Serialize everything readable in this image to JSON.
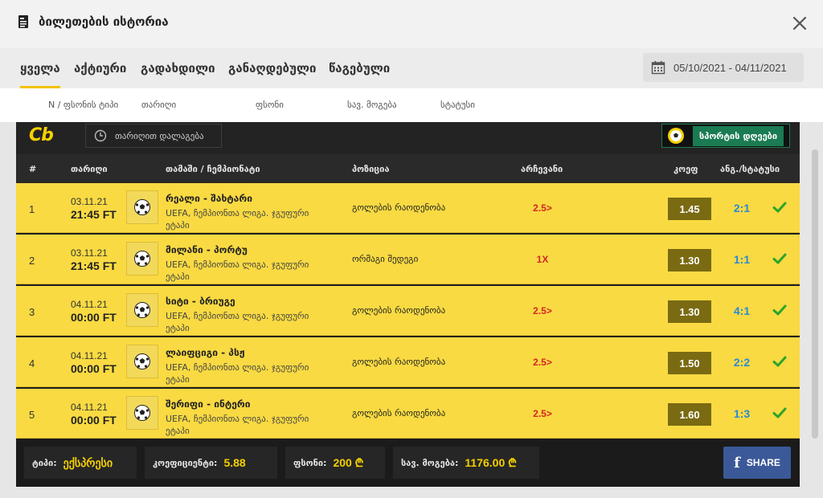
{
  "header": {
    "title": "ბილეთების ისტორია"
  },
  "tabs": [
    {
      "label": "ყველა",
      "active": true
    },
    {
      "label": "აქტიური",
      "active": false
    },
    {
      "label": "გადახდილი",
      "active": false
    },
    {
      "label": "განაღდებული",
      "active": false
    },
    {
      "label": "წაგებული",
      "active": false
    }
  ],
  "date_range": {
    "value": "05/10/2021 - 04/11/2021"
  },
  "columns": {
    "n_type": "N / ფსონის ტიპი",
    "date": "თარიღი",
    "stake": "ფსონი",
    "potential_win": "სავ. მოგება",
    "status": "სტატუსი"
  },
  "ticket": {
    "logo": "Cb",
    "sort_label": "თარიღით დალაგება",
    "sports_button_label": "სპორტის დღეები",
    "table_headers": {
      "num": "#",
      "date": "თარიღი",
      "event": "თამაში / ჩემპიონატი",
      "market": "პოზიცია",
      "outcome": "არჩევანი",
      "odds": "კოეფ",
      "result": "ანგ./სტატუსი"
    },
    "rows": [
      {
        "num": "1",
        "date": "03.11.21",
        "time": "21:45 FT",
        "teams": "რეალი - შახტარი",
        "league": "UEFA, ჩემპიონთა ლიგა. ჯგუფური ეტაპი",
        "market": "გოლების რაოდენობა",
        "outcome": "2.5>",
        "odds": "1.45",
        "score": "2:1"
      },
      {
        "num": "2",
        "date": "03.11.21",
        "time": "21:45 FT",
        "teams": "მილანი - პორტუ",
        "league": "UEFA, ჩემპიონთა ლიგა. ჯგუფური ეტაპი",
        "market": "ორმაგი შედეგი",
        "outcome": "1X",
        "odds": "1.30",
        "score": "1:1"
      },
      {
        "num": "3",
        "date": "04.11.21",
        "time": "00:00 FT",
        "teams": "სიტი - ბრიუგე",
        "league": "UEFA, ჩემპიონთა ლიგა. ჯგუფური ეტაპი",
        "market": "გოლების რაოდენობა",
        "outcome": "2.5>",
        "odds": "1.30",
        "score": "4:1"
      },
      {
        "num": "4",
        "date": "04.11.21",
        "time": "00:00 FT",
        "teams": "ლაიფციგი - პსჟ",
        "league": "UEFA, ჩემპიონთა ლიგა. ჯგუფური ეტაპი",
        "market": "გოლების რაოდენობა",
        "outcome": "2.5>",
        "odds": "1.50",
        "score": "2:2"
      },
      {
        "num": "5",
        "date": "04.11.21",
        "time": "00:00 FT",
        "teams": "შერიფი - ინტერი",
        "league": "UEFA, ჩემპიონთა ლიგა. ჯგუფური ეტაპი",
        "market": "გოლების რაოდენობა",
        "outcome": "2.5>",
        "odds": "1.60",
        "score": "1:3"
      }
    ],
    "footer": {
      "type_label": "ტიპი:",
      "type_value": "ექსპრესი",
      "coef_label": "კოეფიციენტი:",
      "coef_value": "5.88",
      "stake_label": "ფსონი:",
      "stake_value": "200 ₾",
      "win_label": "სავ. მოგება:",
      "win_value": "1176.00 ₾",
      "share_label": "SHARE"
    }
  },
  "colors": {
    "accent": "#f3c300",
    "row_bg": "#f9da42",
    "odds_bg": "#7a6a12",
    "outcome_red": "#d32626",
    "score_blue": "#2a8ad6",
    "check_green": "#2aa52a",
    "facebook": "#3b5998"
  },
  "icons": [
    "ticket-doc-icon",
    "close-icon",
    "calendar-icon",
    "clock-icon",
    "soccer-ball-icon",
    "check-icon",
    "facebook-icon"
  ]
}
